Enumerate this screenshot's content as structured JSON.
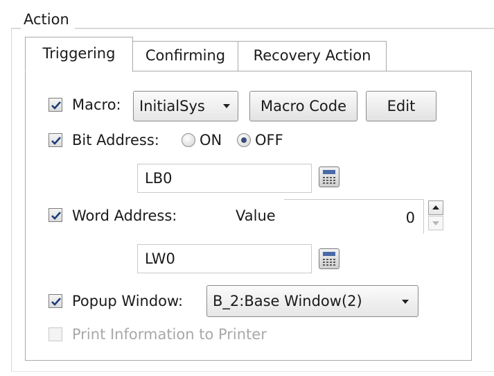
{
  "group": {
    "title": "Action"
  },
  "tabs": [
    {
      "label": "Triggering",
      "active": true
    },
    {
      "label": "Confirming",
      "active": false
    },
    {
      "label": "Recovery Action",
      "active": false
    }
  ],
  "macro": {
    "checked": true,
    "label": "Macro:",
    "selected": "InitialSys",
    "code_button": "Macro Code",
    "edit_button": "Edit"
  },
  "bit_address": {
    "checked": true,
    "label": "Bit Address:",
    "on_label": "ON",
    "off_label": "OFF",
    "selected": "OFF",
    "value": "LB0"
  },
  "word_address": {
    "checked": true,
    "label": "Word Address:",
    "value_label": "Value",
    "value": "0",
    "address": "LW0"
  },
  "popup_window": {
    "checked": true,
    "label": "Popup Window:",
    "selected": "B_2:Base Window(2)"
  },
  "print_info": {
    "checked": false,
    "enabled": false,
    "label": "Print Information to Printer"
  },
  "colors": {
    "radio_dot": "#3a4f7a",
    "border": "#a9a9a9",
    "disabled_text": "#a8a8a8"
  }
}
